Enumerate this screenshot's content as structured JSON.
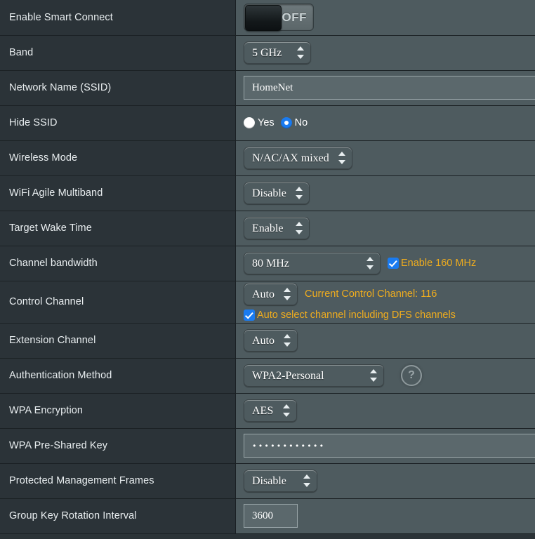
{
  "rows": [
    {
      "label": "Enable Smart Connect",
      "control": "toggle",
      "toggle_state": "OFF"
    },
    {
      "label": "Band",
      "control": "select",
      "value": "5 GHz"
    },
    {
      "label": "Network Name (SSID)",
      "control": "text",
      "value": "HomeNet"
    },
    {
      "label": "Hide SSID",
      "control": "radio",
      "options": [
        "Yes",
        "No"
      ],
      "selected": "No"
    },
    {
      "label": "Wireless Mode",
      "control": "select",
      "value": "N/AC/AX mixed"
    },
    {
      "label": "WiFi Agile Multiband",
      "control": "select",
      "value": "Disable"
    },
    {
      "label": "Target Wake Time",
      "control": "select",
      "value": "Enable"
    },
    {
      "label": "Channel bandwidth",
      "control": "select-check",
      "value": "80 MHz",
      "checkbox_label": "Enable 160 MHz",
      "checkbox_checked": true
    },
    {
      "label": "Control Channel",
      "control": "select-note-check",
      "value": "Auto",
      "note": "Current Control Channel: 116",
      "checkbox_label": "Auto select channel including DFS channels",
      "checkbox_checked": true
    },
    {
      "label": "Extension Channel",
      "control": "select",
      "value": "Auto"
    },
    {
      "label": "Authentication Method",
      "control": "select-help",
      "value": "WPA2-Personal",
      "help_icon": "help-circle-icon",
      "help_glyph": "?"
    },
    {
      "label": "WPA Encryption",
      "control": "select",
      "value": "AES"
    },
    {
      "label": "WPA Pre-Shared Key",
      "control": "password",
      "value": "••••••••••••"
    },
    {
      "label": "Protected Management Frames",
      "control": "select",
      "value": "Disable"
    },
    {
      "label": "Group Key Rotation Interval",
      "control": "number",
      "value": "3600"
    }
  ],
  "colors": {
    "label_column_bg": "#2b3338",
    "value_column_bg": "#4e5b5f",
    "divider": "#1b2124",
    "accent_orange": "#f0ad1e",
    "accent_blue": "#1a7bf0",
    "label_text": "#e9eef0"
  }
}
